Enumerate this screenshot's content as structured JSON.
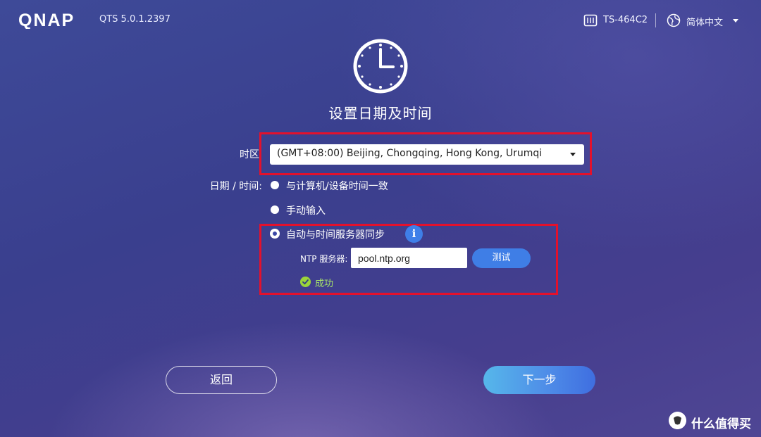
{
  "header": {
    "logo_text": "QNAP",
    "version": "QTS 5.0.1.2397",
    "device_name": "TS-464C2",
    "language": "简体中文",
    "icons": [
      "nas-device-icon",
      "globe-icon",
      "chevron-down-icon"
    ]
  },
  "page": {
    "title": "设置日期及时间",
    "icon": "clock-icon"
  },
  "form": {
    "timezone_label": "时区",
    "timezone_value": "(GMT+08:00) Beijing, Chongqing, Hong Kong, Urumqi",
    "datetime_label": "日期 / 时间:",
    "options": [
      {
        "label": "与计算机/设备时间一致",
        "selected": false
      },
      {
        "label": "手动输入",
        "selected": false
      },
      {
        "label": "自动与时间服务器同步",
        "selected": true
      }
    ],
    "ntp_label": "NTP 服务器:",
    "ntp_value": "pool.ntp.org",
    "test_button": "测试",
    "status_text": "成功"
  },
  "buttons": {
    "back": "返回",
    "next": "下一步"
  },
  "watermark": {
    "text": "什么值得买"
  },
  "colors": {
    "highlight_border": "#e3112c",
    "primary_blue": "#3f7ee6",
    "success_green": "#9bd43a"
  }
}
